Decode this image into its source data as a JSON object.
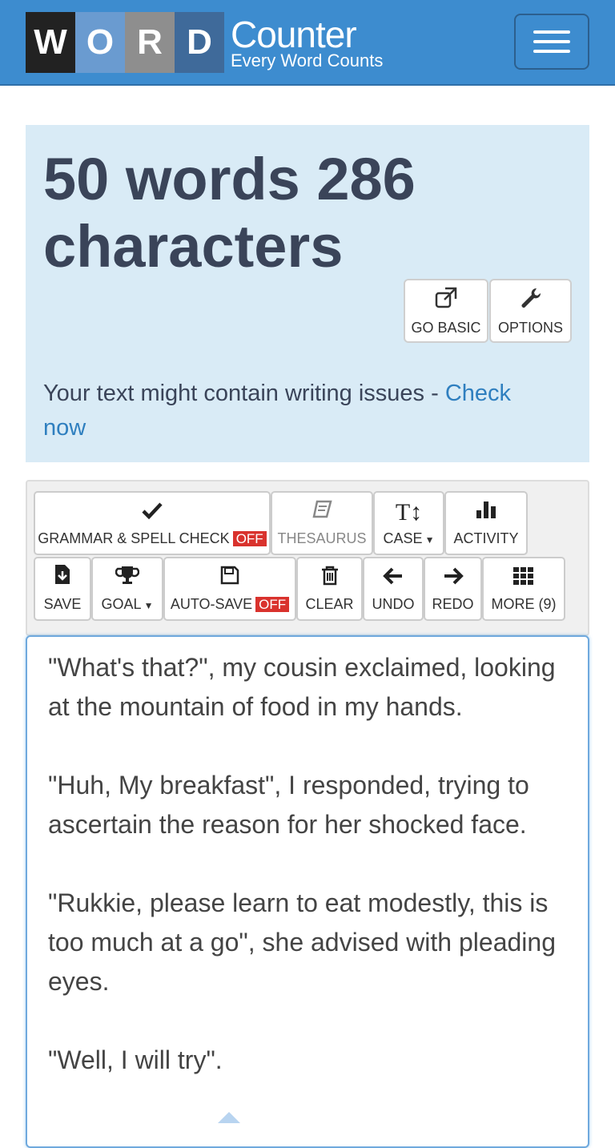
{
  "header": {
    "logo_letters": [
      "W",
      "O",
      "R",
      "D"
    ],
    "brand_title": "Counter",
    "brand_tagline": "Every Word Counts",
    "menu_icon": "hamburger-icon",
    "bar_color": "#3d8ccf"
  },
  "stats": {
    "summary": "50 words 286 characters",
    "go_basic_label": "GO BASIC",
    "go_basic_icon": "external-link-icon",
    "options_label": "OPTIONS",
    "options_icon": "wrench-icon",
    "issues_text": "Your text might contain writing issues - ",
    "issues_link": "Check now"
  },
  "toolbar": {
    "grammar_label": "GRAMMAR & SPELL CHECK",
    "grammar_state": "OFF",
    "thesaurus_label": "THESAURUS",
    "case_label": "CASE",
    "activity_label": "ACTIVITY",
    "save_label": "SAVE",
    "goal_label": "GOAL",
    "autosave_label": "AUTO-SAVE",
    "autosave_state": "OFF",
    "clear_label": "CLEAR",
    "undo_label": "UNDO",
    "redo_label": "REDO",
    "more_label": "MORE (9)",
    "off_color": "#d9322d"
  },
  "editor": {
    "text": "\"What's that?\", my cousin exclaimed, looking at the mountain of food in my hands.\n\n\"Huh, My breakfast\", I responded, trying to ascertain the reason for her shocked face.\n\n\"Rukkie, please learn to eat modestly, this is too much at a go\", she advised with pleading eyes.\n\n\"Well, I will try\"."
  }
}
